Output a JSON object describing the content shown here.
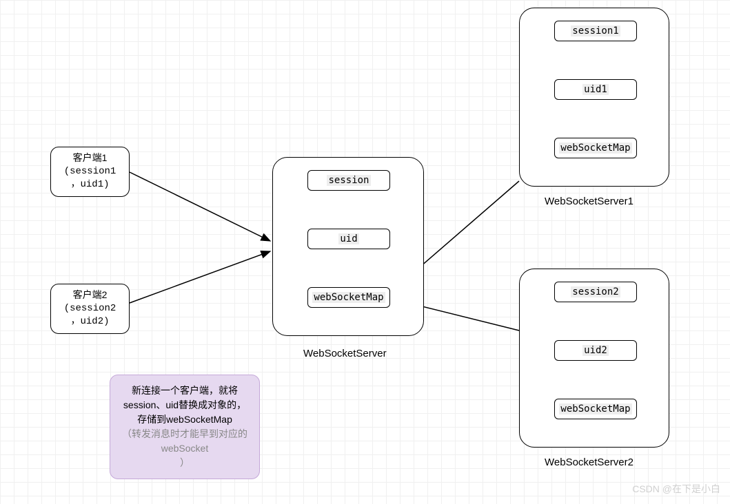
{
  "clients": {
    "c1": {
      "title": "客户端1",
      "line1": "(session1",
      "line2": "，uid1)"
    },
    "c2": {
      "title": "客户端2",
      "line1": "(session2",
      "line2": "，uid2)"
    }
  },
  "center": {
    "label": "WebSocketServer",
    "box1": "session",
    "box2": "uid",
    "box3": "webSocketMap"
  },
  "server1": {
    "label": "WebSocketServer1",
    "box1": "session1",
    "box2": "uid1",
    "box3": "webSocketMap"
  },
  "server2": {
    "label": "WebSocketServer2",
    "box1": "session2",
    "box2": "uid2",
    "box3": "webSocketMap"
  },
  "note": {
    "line1": "新连接一个客户端，就将",
    "line2": "session、uid替换成对象的，",
    "line3": "存储到webSocketMap",
    "line4": "（转发消息时才能早到对应的",
    "line5": "webSocket",
    "line6": "）"
  },
  "watermark": "CSDN @在下是小白"
}
